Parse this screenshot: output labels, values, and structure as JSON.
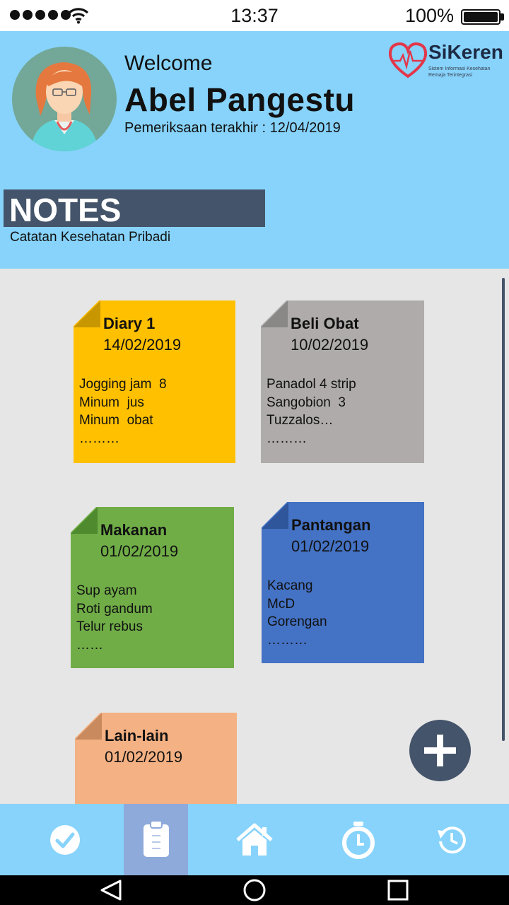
{
  "status_bar": {
    "time": "13:37",
    "battery": "100%",
    "battery_level": 1.0,
    "signal_icon": "signal-dots-icon",
    "wifi_icon": "wifi-icon"
  },
  "header": {
    "welcome": "Welcome",
    "user_name": "Abel Pangestu",
    "last_check_label": "Pemeriksaan terakhir :",
    "last_check_date": "12/04/2019",
    "avatar_icon": "user-avatar-icon",
    "background_color": "#87d3fb"
  },
  "logo": {
    "name": "SiKeren",
    "tagline_line1": "Sistem Informasi Kesehatan",
    "tagline_line2": "Remaja Terintegrasi",
    "icon": "heart-pulse-icon"
  },
  "section": {
    "title": "NOTES",
    "subtitle": "Catatan Kesehatan Pribadi"
  },
  "notes": [
    {
      "title": "Diary 1",
      "date": "14/02/2019",
      "lines": [
        "Jogging jam  8",
        "Minum  jus",
        "Minum  obat",
        "………"
      ],
      "color": "#ffc000",
      "fold_color": "#c89700"
    },
    {
      "title": "Beli Obat",
      "date": "10/02/2019",
      "lines": [
        "Panadol 4 strip",
        "Sangobion  3",
        "Tuzzalos…",
        "………"
      ],
      "color": "#afabab",
      "fold_color": "#8a8787"
    },
    {
      "title": "Makanan",
      "date": "01/02/2019",
      "lines": [
        "Sup ayam",
        "Roti gandum",
        "Telur rebus",
        "……"
      ],
      "color": "#70ad47",
      "fold_color": "#4f8a2e"
    },
    {
      "title": "Pantangan",
      "date": "01/02/2019",
      "lines": [
        "Kacang",
        "McD",
        "Gorengan",
        "………"
      ],
      "color": "#4472c4",
      "fold_color": "#2f559a"
    },
    {
      "title": "Lain-lain",
      "date": "01/02/2019",
      "lines": [],
      "color": "#f4b183",
      "fold_color": "#c98a5e"
    }
  ],
  "fab": {
    "icon": "plus-icon"
  },
  "bottom_nav": [
    {
      "icon": "check-circle-icon",
      "active": false
    },
    {
      "icon": "clipboard-icon",
      "active": true
    },
    {
      "icon": "home-icon",
      "active": false
    },
    {
      "icon": "stopwatch-icon",
      "active": false
    },
    {
      "icon": "history-icon",
      "active": false
    }
  ],
  "android_nav": [
    {
      "icon": "back-triangle-icon"
    },
    {
      "icon": "home-circle-icon"
    },
    {
      "icon": "recent-square-icon"
    }
  ]
}
